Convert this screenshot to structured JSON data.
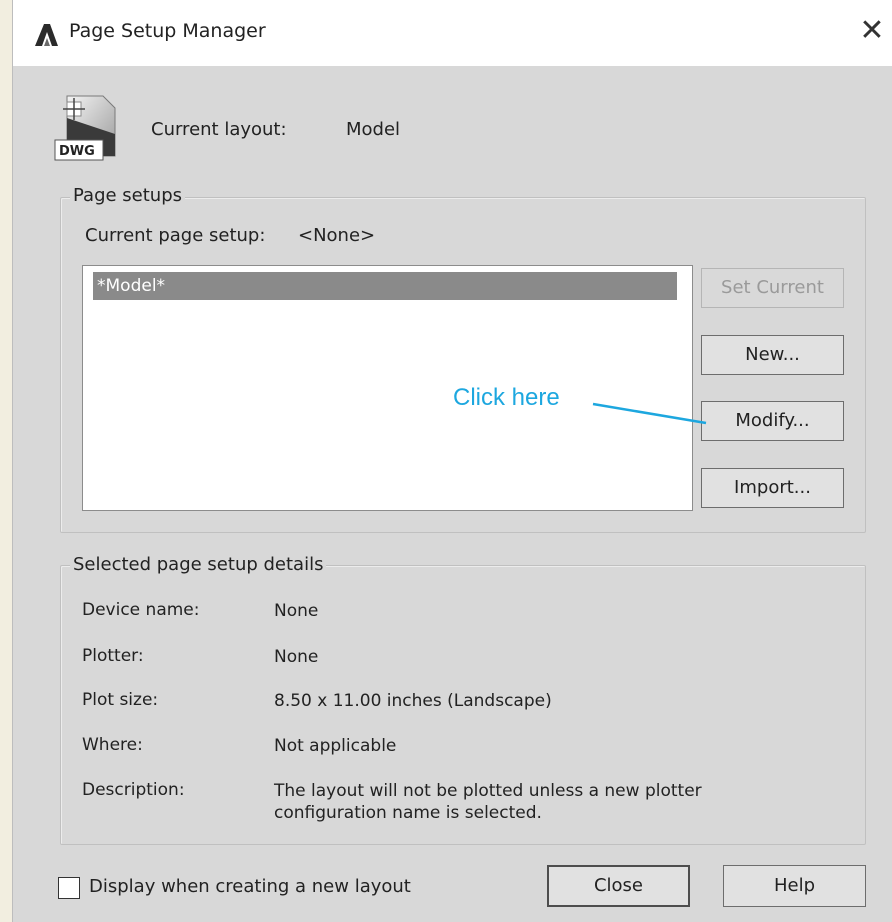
{
  "window": {
    "title": "Page Setup Manager",
    "app_icon": "autocad-a-icon",
    "close_glyph": "✕"
  },
  "current_layout": {
    "icon": "dwg-file-icon",
    "icon_text": "DWG",
    "label": "Current layout:",
    "value": "Model"
  },
  "page_setups": {
    "group_label": "Page setups",
    "current_label": "Current page setup:",
    "current_value": "<None>",
    "items": [
      "*Model*"
    ],
    "buttons": {
      "set_current": "Set Current",
      "new": "New...",
      "modify": "Modify...",
      "import": "Import..."
    }
  },
  "callout": {
    "text": "Click here",
    "color": "#1da7df"
  },
  "details": {
    "group_label": "Selected page setup details",
    "rows": [
      {
        "label": "Device name:",
        "value": "None"
      },
      {
        "label": "Plotter:",
        "value": "None"
      },
      {
        "label": "Plot size:",
        "value": "8.50 x 11.00 inches (Landscape)"
      },
      {
        "label": "Where:",
        "value": "Not applicable"
      },
      {
        "label": "Description:",
        "value_line1": "The layout will not be plotted unless a new plotter",
        "value_line2": "configuration name is selected."
      }
    ]
  },
  "footer": {
    "checkbox_label": "Display when creating a new layout",
    "checkbox_checked": false,
    "close_button": "Close",
    "help_button": "Help"
  }
}
